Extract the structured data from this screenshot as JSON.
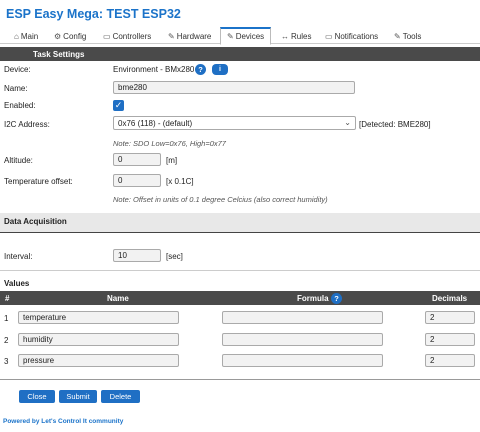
{
  "app_title": "ESP Easy Mega: TEST ESP32",
  "tabs": [
    {
      "icon": "⌂",
      "label": "Main"
    },
    {
      "icon": "⚙",
      "label": "Config"
    },
    {
      "icon": "▭",
      "label": "Controllers"
    },
    {
      "icon": "✎",
      "label": "Hardware"
    },
    {
      "icon": "✎",
      "label": "Devices"
    },
    {
      "icon": "↔",
      "label": "Rules"
    },
    {
      "icon": "▭",
      "label": "Notifications"
    },
    {
      "icon": "✎",
      "label": "Tools"
    }
  ],
  "task_settings": {
    "header": "Task Settings",
    "device_label": "Device:",
    "device_value": "Environment - BMx280",
    "help_glyph": "?",
    "info_glyph": "i",
    "name_label": "Name:",
    "name_value": "bme280",
    "enabled_label": "Enabled:",
    "enabled_checked": true,
    "i2c_label": "I2C Address:",
    "i2c_value": "0x76 (118) - (default)",
    "i2c_detected": "[Detected: BME280]",
    "i2c_note": "Note: SDO Low=0x76, High=0x77",
    "altitude_label": "Altitude:",
    "altitude_value": "0",
    "altitude_unit": "[m]",
    "temp_offset_label": "Temperature offset:",
    "temp_offset_value": "0",
    "temp_offset_unit": "[x 0.1C]",
    "temp_offset_note": "Note: Offset in units of 0.1 degree Celcius (also correct humidity)"
  },
  "data_acquisition": {
    "header": "Data Acquisition",
    "interval_label": "Interval:",
    "interval_value": "10",
    "interval_unit": "[sec]"
  },
  "values": {
    "header": "Values",
    "columns": {
      "num": "#",
      "name": "Name",
      "formula": "Formula",
      "decimals": "Decimals"
    },
    "rows": [
      {
        "num": "1",
        "name": "temperature",
        "formula": "",
        "decimals": "2"
      },
      {
        "num": "2",
        "name": "humidity",
        "formula": "",
        "decimals": "2"
      },
      {
        "num": "3",
        "name": "pressure",
        "formula": "",
        "decimals": "2"
      }
    ]
  },
  "buttons": {
    "close": "Close",
    "submit": "Submit",
    "delete": "Delete"
  },
  "footer": "Powered by Let's Control It community",
  "colors": {
    "accent": "#1f6fc4",
    "title": "#1b73c9",
    "table_header": "#4a4a4a"
  }
}
